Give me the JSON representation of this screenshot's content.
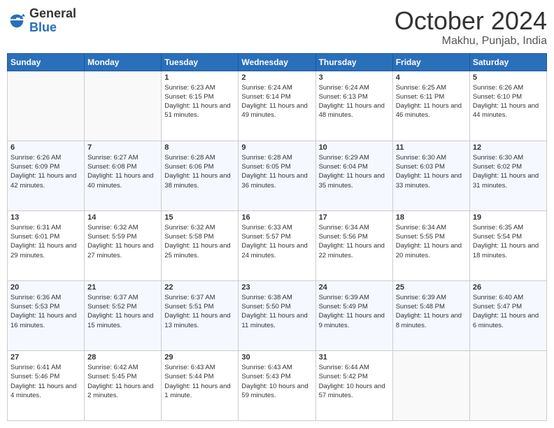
{
  "logo": {
    "general": "General",
    "blue": "Blue"
  },
  "header": {
    "month": "October 2024",
    "location": "Makhu, Punjab, India"
  },
  "days_of_week": [
    "Sunday",
    "Monday",
    "Tuesday",
    "Wednesday",
    "Thursday",
    "Friday",
    "Saturday"
  ],
  "weeks": [
    [
      {
        "day": "",
        "empty": true
      },
      {
        "day": "",
        "empty": true
      },
      {
        "day": "1",
        "sunrise": "6:23 AM",
        "sunset": "6:15 PM",
        "daylight": "11 hours and 51 minutes."
      },
      {
        "day": "2",
        "sunrise": "6:24 AM",
        "sunset": "6:14 PM",
        "daylight": "11 hours and 49 minutes."
      },
      {
        "day": "3",
        "sunrise": "6:24 AM",
        "sunset": "6:13 PM",
        "daylight": "11 hours and 48 minutes."
      },
      {
        "day": "4",
        "sunrise": "6:25 AM",
        "sunset": "6:11 PM",
        "daylight": "11 hours and 46 minutes."
      },
      {
        "day": "5",
        "sunrise": "6:26 AM",
        "sunset": "6:10 PM",
        "daylight": "11 hours and 44 minutes."
      }
    ],
    [
      {
        "day": "6",
        "sunrise": "6:26 AM",
        "sunset": "6:09 PM",
        "daylight": "11 hours and 42 minutes."
      },
      {
        "day": "7",
        "sunrise": "6:27 AM",
        "sunset": "6:08 PM",
        "daylight": "11 hours and 40 minutes."
      },
      {
        "day": "8",
        "sunrise": "6:28 AM",
        "sunset": "6:06 PM",
        "daylight": "11 hours and 38 minutes."
      },
      {
        "day": "9",
        "sunrise": "6:28 AM",
        "sunset": "6:05 PM",
        "daylight": "11 hours and 36 minutes."
      },
      {
        "day": "10",
        "sunrise": "6:29 AM",
        "sunset": "6:04 PM",
        "daylight": "11 hours and 35 minutes."
      },
      {
        "day": "11",
        "sunrise": "6:30 AM",
        "sunset": "6:03 PM",
        "daylight": "11 hours and 33 minutes."
      },
      {
        "day": "12",
        "sunrise": "6:30 AM",
        "sunset": "6:02 PM",
        "daylight": "11 hours and 31 minutes."
      }
    ],
    [
      {
        "day": "13",
        "sunrise": "6:31 AM",
        "sunset": "6:01 PM",
        "daylight": "11 hours and 29 minutes."
      },
      {
        "day": "14",
        "sunrise": "6:32 AM",
        "sunset": "5:59 PM",
        "daylight": "11 hours and 27 minutes."
      },
      {
        "day": "15",
        "sunrise": "6:32 AM",
        "sunset": "5:58 PM",
        "daylight": "11 hours and 25 minutes."
      },
      {
        "day": "16",
        "sunrise": "6:33 AM",
        "sunset": "5:57 PM",
        "daylight": "11 hours and 24 minutes."
      },
      {
        "day": "17",
        "sunrise": "6:34 AM",
        "sunset": "5:56 PM",
        "daylight": "11 hours and 22 minutes."
      },
      {
        "day": "18",
        "sunrise": "6:34 AM",
        "sunset": "5:55 PM",
        "daylight": "11 hours and 20 minutes."
      },
      {
        "day": "19",
        "sunrise": "6:35 AM",
        "sunset": "5:54 PM",
        "daylight": "11 hours and 18 minutes."
      }
    ],
    [
      {
        "day": "20",
        "sunrise": "6:36 AM",
        "sunset": "5:53 PM",
        "daylight": "11 hours and 16 minutes."
      },
      {
        "day": "21",
        "sunrise": "6:37 AM",
        "sunset": "5:52 PM",
        "daylight": "11 hours and 15 minutes."
      },
      {
        "day": "22",
        "sunrise": "6:37 AM",
        "sunset": "5:51 PM",
        "daylight": "11 hours and 13 minutes."
      },
      {
        "day": "23",
        "sunrise": "6:38 AM",
        "sunset": "5:50 PM",
        "daylight": "11 hours and 11 minutes."
      },
      {
        "day": "24",
        "sunrise": "6:39 AM",
        "sunset": "5:49 PM",
        "daylight": "11 hours and 9 minutes."
      },
      {
        "day": "25",
        "sunrise": "6:39 AM",
        "sunset": "5:48 PM",
        "daylight": "11 hours and 8 minutes."
      },
      {
        "day": "26",
        "sunrise": "6:40 AM",
        "sunset": "5:47 PM",
        "daylight": "11 hours and 6 minutes."
      }
    ],
    [
      {
        "day": "27",
        "sunrise": "6:41 AM",
        "sunset": "5:46 PM",
        "daylight": "11 hours and 4 minutes."
      },
      {
        "day": "28",
        "sunrise": "6:42 AM",
        "sunset": "5:45 PM",
        "daylight": "11 hours and 2 minutes."
      },
      {
        "day": "29",
        "sunrise": "6:43 AM",
        "sunset": "5:44 PM",
        "daylight": "11 hours and 1 minute."
      },
      {
        "day": "30",
        "sunrise": "6:43 AM",
        "sunset": "5:43 PM",
        "daylight": "10 hours and 59 minutes."
      },
      {
        "day": "31",
        "sunrise": "6:44 AM",
        "sunset": "5:42 PM",
        "daylight": "10 hours and 57 minutes."
      },
      {
        "day": "",
        "empty": true
      },
      {
        "day": "",
        "empty": true
      }
    ]
  ]
}
